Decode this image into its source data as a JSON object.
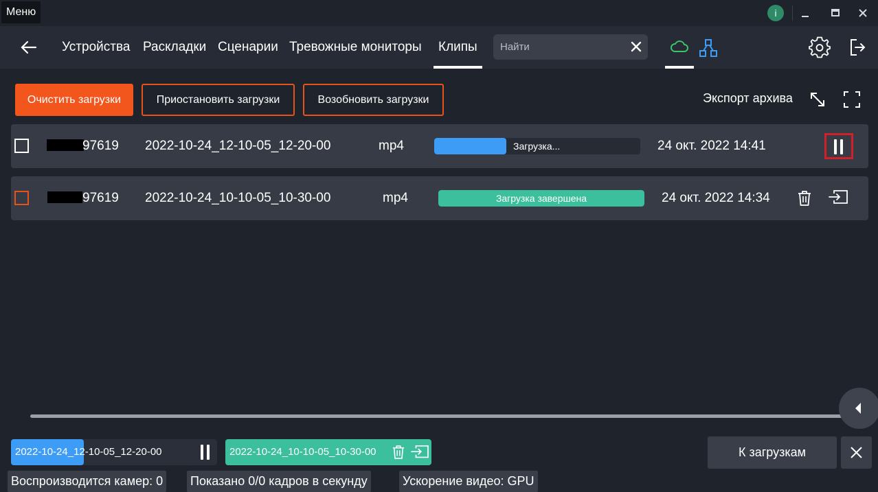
{
  "titlebar": {
    "menu_label": "Меню",
    "info_label": "i"
  },
  "nav": {
    "tabs": [
      {
        "label": "Устройства"
      },
      {
        "label": "Раскладки"
      },
      {
        "label": "Сценарии"
      },
      {
        "label": "Тревожные мониторы"
      },
      {
        "label": "Клипы",
        "active": true
      }
    ],
    "search": {
      "placeholder": "Найти",
      "value": ""
    },
    "icons": [
      "back-arrow-icon",
      "close-icon",
      "cloud-icon",
      "network-icon",
      "gear-icon",
      "logout-icon"
    ]
  },
  "toolbar": {
    "clear_label": "Очистить загрузки",
    "pause_label": "Приостановить загрузки",
    "resume_label": "Возобновить загрузки",
    "export_label": "Экспорт архива"
  },
  "rows": [
    {
      "camera": "97619",
      "name": "2022-10-24_12-10-05_12-20-00",
      "format": "mp4",
      "status": "Загрузка...",
      "progress": 0.35,
      "date": "24 окт. 2022 14:41"
    },
    {
      "camera": "97619",
      "name": "2022-10-24_10-10-05_10-30-00",
      "format": "mp4",
      "status": "Загрузка завершена",
      "progress": 1.0,
      "date": "24 окт. 2022 14:34"
    }
  ],
  "bottom": {
    "chips": [
      {
        "label": "2022-10-24_12-10-05_12-20-00",
        "progress": 0.35
      },
      {
        "label": "2022-10-24_10-10-05_10-30-00",
        "progress": 1.0
      }
    ],
    "to_downloads_label": "К загрузкам"
  },
  "status": {
    "cameras": "Воспроизводится камер: 0",
    "fps": "Показано 0/0 кадров в секунду",
    "accel": "Ускорение видео: GPU"
  },
  "colors": {
    "accent_orange": "#f2561d",
    "progress_blue": "#3d9cf5",
    "done_green": "#3bbf9c",
    "highlight_red": "#d0212a"
  }
}
